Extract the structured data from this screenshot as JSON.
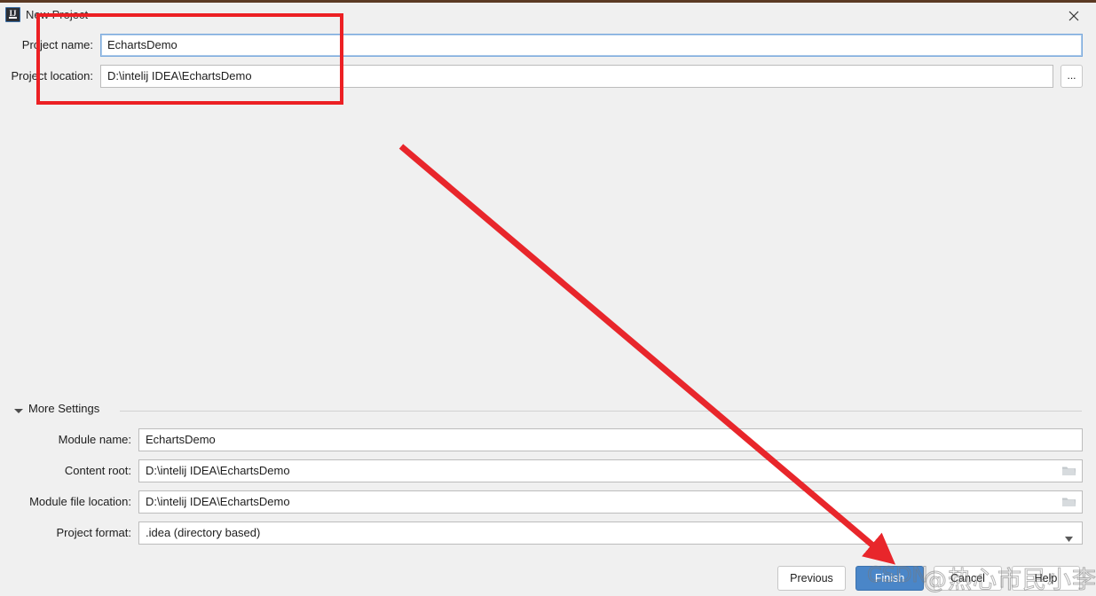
{
  "window": {
    "title": "New Project",
    "app_icon": "intellij-idea-icon",
    "icon_letters": "IJ",
    "close_icon": "close-icon"
  },
  "main_fields": [
    {
      "label": "Project name:",
      "value": "EchartsDemo",
      "name": "project-name"
    },
    {
      "label": "Project location:",
      "value": "D:\\intelij IDEA\\EchartsDemo",
      "name": "project-location",
      "browse_label": "..."
    }
  ],
  "more_settings": {
    "label": "More Settings",
    "expanded": true,
    "fields": [
      {
        "label": "Module name:",
        "value": "EchartsDemo",
        "name": "module-name",
        "trailing_icon": "none"
      },
      {
        "label": "Content root:",
        "value": "D:\\intelij IDEA\\EchartsDemo",
        "name": "content-root",
        "trailing_icon": "folder-icon"
      },
      {
        "label": "Module file location:",
        "value": "D:\\intelij IDEA\\EchartsDemo",
        "name": "module-file-location",
        "trailing_icon": "folder-icon"
      },
      {
        "label": "Project format:",
        "value": ".idea (directory based)",
        "name": "project-format",
        "trailing_icon": "chevron-down-icon"
      }
    ]
  },
  "buttons": {
    "previous": "Previous",
    "finish": "Finish",
    "cancel": "Cancel",
    "help": "Help"
  },
  "annotations": {
    "highlight_color": "#ec2024",
    "arrow_color": "#e8262b"
  },
  "watermark": {
    "brand": "CSDN",
    "author": "@热心市民小李同学"
  },
  "colors": {
    "accent": "#4a86c8",
    "background": "#f0f0f0",
    "field_border": "#bcbcbc",
    "focus_border": "#7aa9dd"
  }
}
